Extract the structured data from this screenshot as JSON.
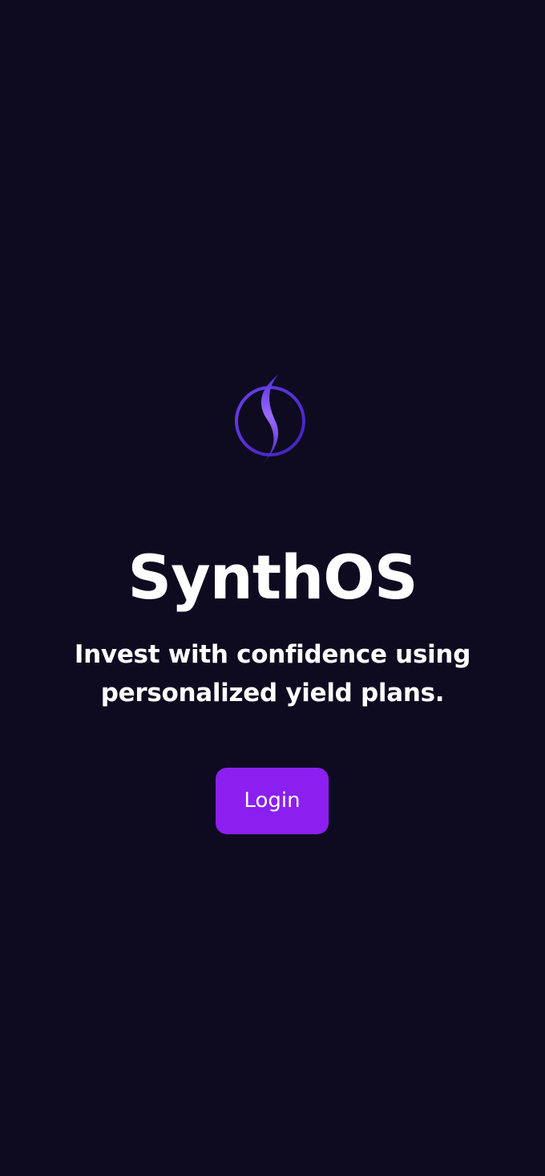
{
  "app": {
    "logo_icon": "synthos-swirl-logo-icon",
    "title": "SynthOS",
    "tagline": "Invest with confidence using personalized yield plans."
  },
  "actions": {
    "login_label": "Login"
  },
  "colors": {
    "background": "#0e0b20",
    "accent": "#8a1ff0",
    "logo_ring": "#5b2fd6",
    "logo_swirl_light": "#9b6bff",
    "text": "#ffffff"
  }
}
